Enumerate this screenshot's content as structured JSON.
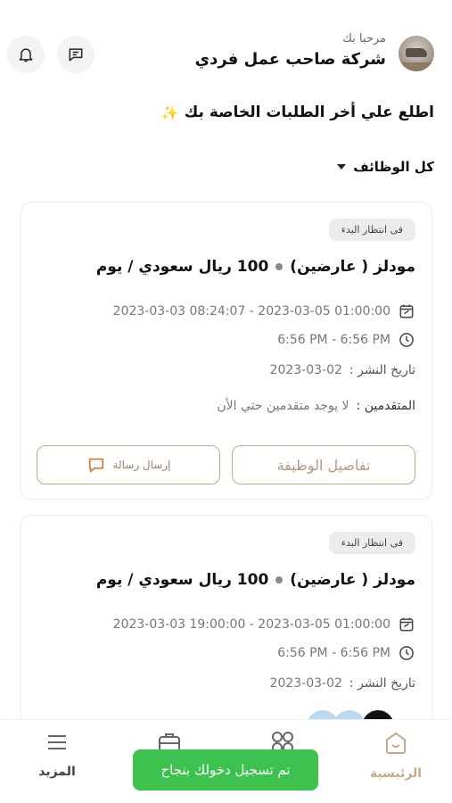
{
  "header": {
    "greeting": "مرحبا بك",
    "company_name": "شركة صاحب عمل فردي",
    "icons": [
      "chat-icon",
      "bell-icon"
    ]
  },
  "subtitle": "اطلع علي أخر الطلبات الخاصة بك",
  "filter": {
    "label": "كل الوظائف"
  },
  "jobs": [
    {
      "status": "فى انتظار البدء",
      "role": "مودلز ( عارضين)",
      "pay": "100 ريال سعودي / يوم",
      "dates": "2023-03-03 08:24:07 - 2023-03-05 01:00:00",
      "time": "6:56 PM - 6:56 PM",
      "published_label": "تاريخ النشر :",
      "published_date": "2023-03-02",
      "applicants_label": "المتقدمين :",
      "applicants_value": "لا يوجد متقدمين حتي الأن",
      "details_button": "تفاصيل الوظيفة",
      "send_button": "إرسال رسالة"
    },
    {
      "status": "فى انتظار البدء",
      "role": "مودلز ( عارضين)",
      "pay": "100 ريال سعودي / يوم",
      "dates": "2023-03-03 19:00:00 - 2023-03-05 01:00:00",
      "time": "6:56 PM - 6:56 PM",
      "published_label": "تاريخ النشر :",
      "published_date": "2023-03-02"
    }
  ],
  "bottom_nav": {
    "home": "الرئيسية",
    "more": "المزيد"
  },
  "toast": "تم تسجيل دخولك بنجاح",
  "colors": {
    "accent": "#c9a98a",
    "toast_bg": "#3dc24f",
    "badge_bg": "#ececec"
  }
}
